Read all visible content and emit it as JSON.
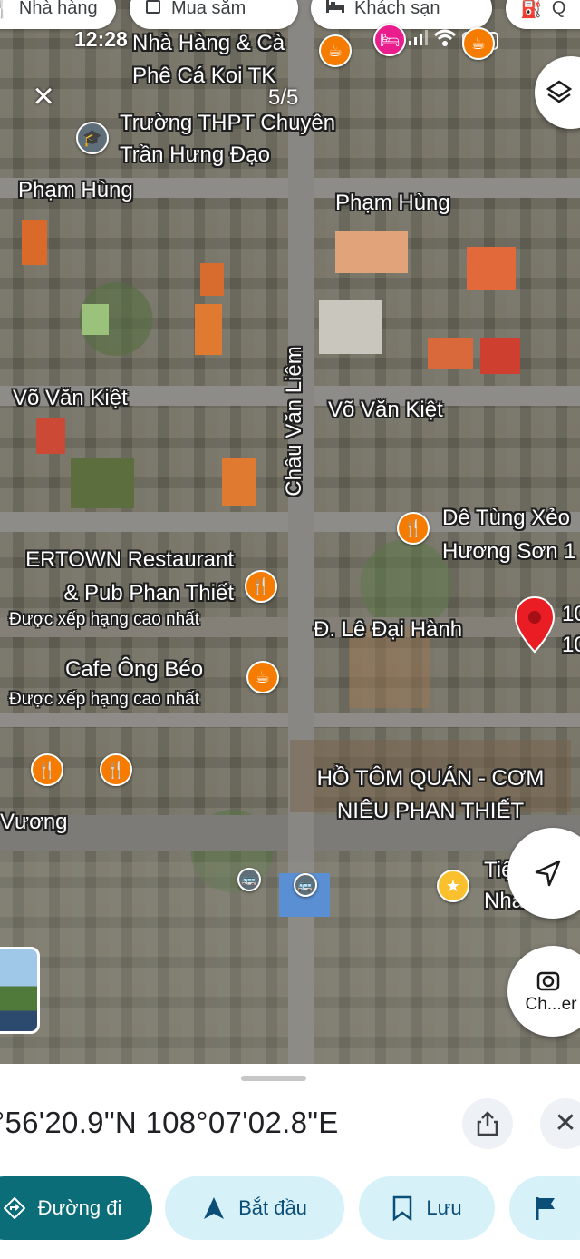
{
  "filter_chips": [
    {
      "label": "Nhà hàng",
      "icon": "fork-knife-icon"
    },
    {
      "label": "Mua sắm",
      "icon": "shopping-bag-icon"
    },
    {
      "label": "Khách sạn",
      "icon": "bed-icon"
    },
    {
      "label": "Q",
      "icon": "gas-pump-icon"
    }
  ],
  "status_bar": {
    "time": "12:28"
  },
  "viewer": {
    "counter": "5/5"
  },
  "streets": {
    "pham_hung": "Phạm Hùng",
    "vo_van_kiet": "Võ Văn Kiệt",
    "chau_van_liem": "Châu Văn Liêm",
    "le_dai_hanh": "Đ. Lê Đại Hành",
    "vuong": "Vương"
  },
  "places": {
    "koi_cafe": "Nhà Hàng & Cà\nPhê Cá Koi TK",
    "school": "Trường THPT Chuyên\nTrần Hưng Đạo",
    "de_tung": "Dê Tùng Xẻo\nHương Sơn 1",
    "ertown": "ERTOWN Restaurant\n& Pub Phan Thiết",
    "ertown_sub": "Được xếp hạng cao nhất",
    "cafe_ong_beo": "Cafe Ông Béo",
    "cafe_ong_beo_sub": "Được xếp hạng cao nhất",
    "ho_tom": "HỒ TÔM QUÁN - CƠM\nNIÊU PHAN THIẾT",
    "tie": "Tiệ\nNhà",
    "pin_label": "10\n10"
  },
  "map_controls": {
    "layers": "layers-icon",
    "directions": "navigation-arrow-icon",
    "lens_label": "Ch...er"
  },
  "sheet": {
    "coordinates": "°56'20.9\"N 108°07'02.8\"E",
    "buttons": {
      "directions": "Đường đi",
      "start": "Bắt đầu",
      "save": "Lưu"
    }
  },
  "colors": {
    "primary": "#0b6d78",
    "secondary": "#d6f1f8",
    "pin_red": "#ea1d24",
    "poi_orange": "#f57c00"
  }
}
